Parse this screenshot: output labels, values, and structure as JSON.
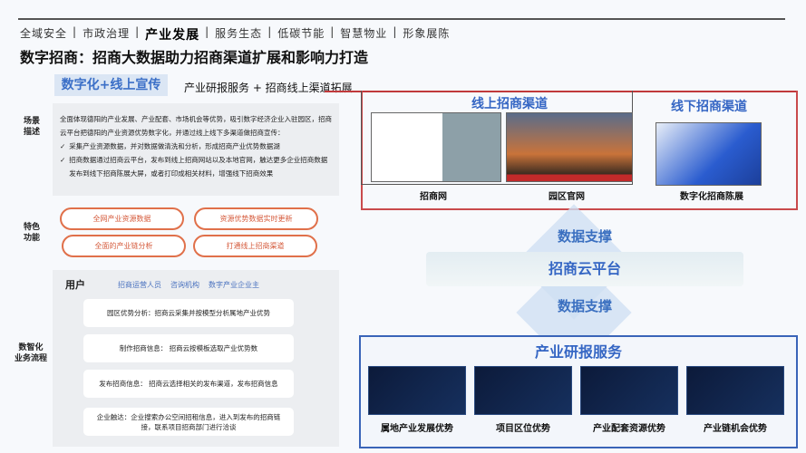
{
  "nav": {
    "items": [
      "全域安全",
      "市政治理",
      "产业发展",
      "服务生态",
      "低碳节能",
      "智慧物业",
      "形象展陈"
    ],
    "active": "产业发展",
    "sep": "|"
  },
  "title": "数字招商：招商大数据助力招商渠道扩展和影响力打造",
  "tag": "数字化+线上宣传",
  "subtitle": "产业研报服务 + 招商线上渠道拓展",
  "labels": {
    "scene": [
      "场景",
      "描述"
    ],
    "feature": [
      "特色",
      "功能"
    ],
    "flow": [
      "数智化",
      "业务流程"
    ]
  },
  "description": {
    "intro": "全面体现德阳的产业发展、产业配套、市场机会等优势，吸引数字经济企业入驻园区，招商云平台把德阳的产业资源优势数字化，并通过线上线下多渠道做招商宣传：",
    "bullets": [
      "采集产业资源数据，并对数据做清洗和分析，形成招商产业优势数据湖",
      "招商数据通过招商云平台，发布到线上招商网站以及本地官网，触达更多企业招商数据发布到线下招商陈展大屏，或者打印成相关材料，增强线下招商效果"
    ],
    "check": "✓"
  },
  "features": [
    "全网产业资源数据",
    "资源优势数据实时更新",
    "全面的产业链分析",
    "打通线上招商渠道"
  ],
  "flow": {
    "user_label": "用户",
    "users": [
      "招商运营人员",
      "咨询机构",
      "数字产业企业主"
    ],
    "steps": [
      "园区优势分析：招商云采集并按模型分析属地产业优势",
      "制作招商信息： 招商云按模板选取产业优势数",
      "发布招商信息： 招商云选择相关的发布渠道，发布招商信息",
      "企业触达：企业搜索办公空间招租信息，进入到发布的招商链接，联系项目招商部门进行洽谈"
    ]
  },
  "channels": {
    "online_title": "线上招商渠道",
    "offline_title": "线下招商渠道",
    "captions": [
      "招商网",
      "园区官网",
      "数字化招商陈展"
    ]
  },
  "support": "数据支撑",
  "platform": "招商云平台",
  "research": {
    "title": "产业研报服务",
    "items": [
      "属地产业发展优势",
      "项目区位优势",
      "产业配套资源优势",
      "产业链机会优势"
    ]
  }
}
